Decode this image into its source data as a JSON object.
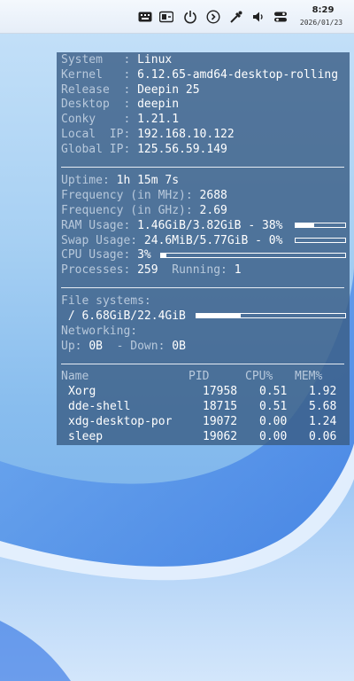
{
  "topbar": {
    "tray_icons": [
      "keyboard-icon",
      "input-method-icon",
      "power-icon",
      "chevron-right-circle-icon",
      "eyedropper-icon",
      "volume-icon",
      "control-center-icon"
    ],
    "clock_time": "8:29",
    "clock_date": "2026/01/23"
  },
  "conky": {
    "system": {
      "system_label": "System   :",
      "system_value": "Linux",
      "kernel_label": "Kernel   :",
      "kernel_value": "6.12.65-amd64-desktop-rolling",
      "release_label": "Release  :",
      "release_value": "Deepin 25",
      "desktop_label": "Desktop  :",
      "desktop_value": "deepin",
      "conky_label": "Conky    :",
      "conky_value": "1.21.1",
      "local_ip_label": "Local  IP:",
      "local_ip_value": "192.168.10.122",
      "global_ip_label": "Global IP:",
      "global_ip_value": "125.56.59.149"
    },
    "stats": {
      "uptime_label": "Uptime:",
      "uptime_value": "1h 15m 7s",
      "freq_mhz_label": "Frequency (in MHz):",
      "freq_mhz_value": "2688",
      "freq_ghz_label": "Frequency (in GHz):",
      "freq_ghz_value": "2.69",
      "ram_label": "RAM Usage:",
      "ram_value": "1.46GiB/3.82GiB - 38%",
      "ram_fraction": 0.38,
      "swap_label": "Swap Usage:",
      "swap_value": "24.6MiB/5.77GiB - 0%",
      "swap_fraction": 0.0,
      "cpu_label": "CPU Usage:",
      "cpu_value": "3%",
      "cpu_fraction": 0.03,
      "processes_label": "Processes:",
      "processes_value": "259",
      "running_label": "Running:",
      "running_value": "1"
    },
    "storage": {
      "filesystems_label": "File systems:",
      "root_label": " /",
      "root_value": "6.68GiB/22.4GiB",
      "root_fraction": 0.298,
      "networking_label": "Networking:",
      "up_label": "Up:",
      "up_value": "0B",
      "down_label": "- Down:",
      "down_value": "0B"
    },
    "processes": {
      "headers": {
        "name": "Name",
        "pid": "PID",
        "cpu": "CPU%",
        "mem": "MEM%"
      },
      "rows": [
        {
          "name": "Xorg",
          "pid": "17958",
          "cpu": "0.51",
          "mem": "1.92"
        },
        {
          "name": "dde-shell",
          "pid": "18715",
          "cpu": "0.51",
          "mem": "5.68"
        },
        {
          "name": "xdg-desktop-por",
          "pid": "19072",
          "cpu": "0.00",
          "mem": "1.24"
        },
        {
          "name": "sleep",
          "pid": "19062",
          "cpu": "0.00",
          "mem": "0.06"
        }
      ]
    }
  }
}
